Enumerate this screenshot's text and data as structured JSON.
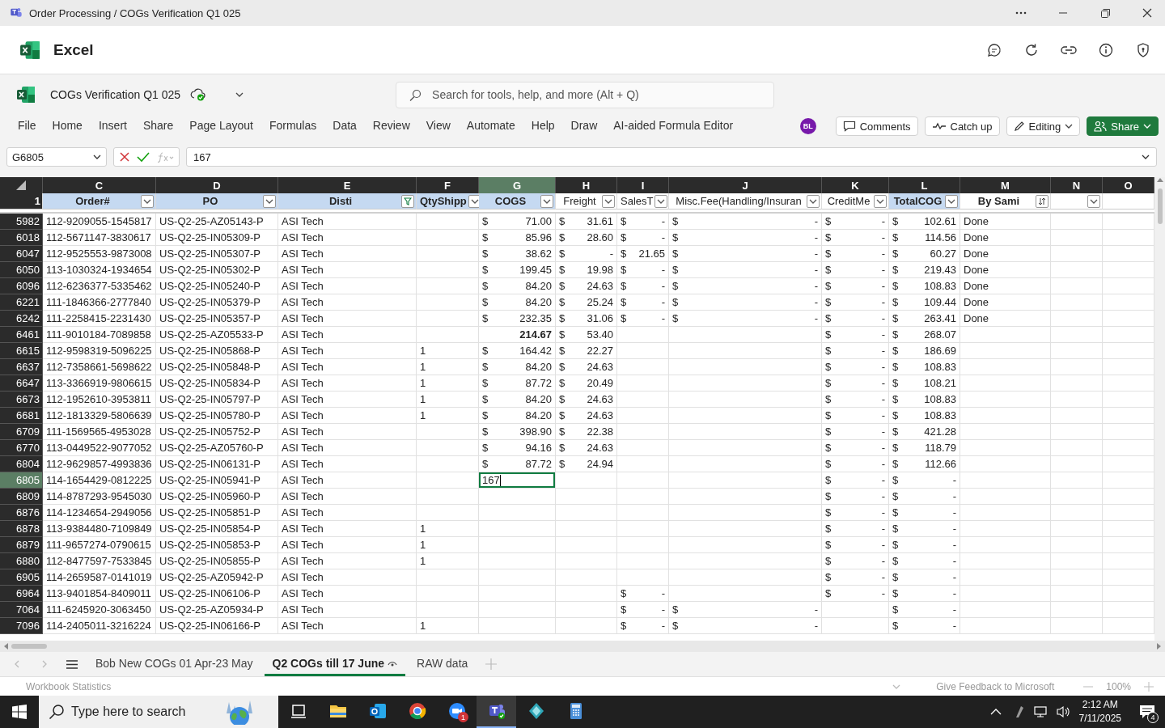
{
  "title_bar": {
    "title": "Order Processing / COGs Verification Q1 025"
  },
  "app_bar": {
    "name": "Excel"
  },
  "document": {
    "name": "COGs Verification Q1 025"
  },
  "search": {
    "placeholder": "Search for tools, help, and more (Alt + Q)"
  },
  "menu": [
    {
      "label": "File",
      "selected": false
    },
    {
      "label": "Home",
      "selected": false
    },
    {
      "label": "Insert",
      "selected": false
    },
    {
      "label": "Share",
      "selected": false
    },
    {
      "label": "Page Layout",
      "selected": false
    },
    {
      "label": "Formulas",
      "selected": false
    },
    {
      "label": "Data",
      "selected": false
    },
    {
      "label": "Review",
      "selected": false
    },
    {
      "label": "View",
      "selected": false
    },
    {
      "label": "Automate",
      "selected": false
    },
    {
      "label": "Help",
      "selected": false
    },
    {
      "label": "Draw",
      "selected": false
    },
    {
      "label": "AI-aided Formula Editor",
      "selected": false
    }
  ],
  "avatar": {
    "initials": "BL"
  },
  "buttons": [
    {
      "label": "Comments",
      "kind": "comments"
    },
    {
      "label": "Catch up",
      "kind": "catchup"
    },
    {
      "label": "Editing",
      "kind": "editing"
    },
    {
      "label": "Share",
      "kind": "share"
    }
  ],
  "formula_bar": {
    "name_box": "G6805",
    "formula": "167"
  },
  "grid": {
    "header_row": "1",
    "columns": [
      {
        "letter": "C",
        "title": "Order#",
        "bold": true,
        "fill": true,
        "kind": "dropdown",
        "selected": false
      },
      {
        "letter": "D",
        "title": "PO",
        "bold": true,
        "fill": true,
        "kind": "dropdown",
        "selected": false
      },
      {
        "letter": "E",
        "title": "Disti",
        "bold": true,
        "fill": true,
        "kind": "filtered",
        "selected": false
      },
      {
        "letter": "F",
        "title": "QtyShipp",
        "bold": true,
        "fill": true,
        "kind": "dropdown",
        "selected": false
      },
      {
        "letter": "G",
        "title": "COGS",
        "bold": true,
        "fill": true,
        "kind": "dropdown",
        "selected": true
      },
      {
        "letter": "H",
        "title": "Freight",
        "bold": false,
        "fill": false,
        "kind": "dropdown",
        "selected": false
      },
      {
        "letter": "I",
        "title": "SalesT",
        "bold": false,
        "fill": false,
        "kind": "dropdown",
        "selected": false
      },
      {
        "letter": "J",
        "title": "Misc.Fee(Handling/Insuran",
        "bold": false,
        "fill": false,
        "kind": "dropdown",
        "selected": false
      },
      {
        "letter": "K",
        "title": "CreditMe",
        "bold": false,
        "fill": false,
        "kind": "dropdown",
        "selected": false
      },
      {
        "letter": "L",
        "title": "TotalCOG",
        "bold": true,
        "fill": true,
        "kind": "dropdown",
        "selected": false
      },
      {
        "letter": "M",
        "title": "By Sami",
        "bold": true,
        "fill": false,
        "kind": "sorted",
        "selected": false
      },
      {
        "letter": "N",
        "fill": false,
        "kind": "dropdown",
        "selected": false
      },
      {
        "letter": "O",
        "fill": false,
        "selected": false
      }
    ],
    "rows": [
      {
        "num": "5982",
        "selected": false,
        "order": "112-9209055-1545817",
        "po": "US-Q2-25-AZ05143-P",
        "disti": "ASI Tech",
        "cogs": {
          "symbol": "$",
          "amount": "71.00"
        },
        "freight": {
          "symbol": "$",
          "amount": "31.61"
        },
        "sales_tax": {
          "symbol": "$",
          "amount": "-"
        },
        "misc_fee": {
          "symbol": "$",
          "amount": "-"
        },
        "credit_memo": {
          "symbol": "$",
          "amount": "-"
        },
        "total_cog": {
          "symbol": "$",
          "amount": "102.61"
        },
        "by_sami": "Done"
      },
      {
        "num": "6018",
        "selected": false,
        "order": "112-5671147-3830617",
        "po": "US-Q2-25-IN05309-P",
        "disti": "ASI Tech",
        "cogs": {
          "symbol": "$",
          "amount": "85.96"
        },
        "freight": {
          "symbol": "$",
          "amount": "28.60"
        },
        "sales_tax": {
          "symbol": "$",
          "amount": "-"
        },
        "misc_fee": {
          "symbol": "$",
          "amount": "-"
        },
        "credit_memo": {
          "symbol": "$",
          "amount": "-"
        },
        "total_cog": {
          "symbol": "$",
          "amount": "114.56"
        },
        "by_sami": "Done"
      },
      {
        "num": "6047",
        "selected": false,
        "order": "112-9525553-9873008",
        "po": "US-Q2-25-IN05307-P",
        "disti": "ASI Tech",
        "cogs": {
          "symbol": "$",
          "amount": "38.62"
        },
        "freight": {
          "symbol": "$",
          "amount": "-"
        },
        "sales_tax": {
          "symbol": "$",
          "amount": "21.65"
        },
        "misc_fee": {
          "symbol": "$",
          "amount": "-"
        },
        "credit_memo": {
          "symbol": "$",
          "amount": "-"
        },
        "total_cog": {
          "symbol": "$",
          "amount": "60.27"
        },
        "by_sami": "Done"
      },
      {
        "num": "6050",
        "selected": false,
        "order": "113-1030324-1934654",
        "po": "US-Q2-25-IN05302-P",
        "disti": "ASI Tech",
        "cogs": {
          "symbol": "$",
          "amount": "199.45"
        },
        "freight": {
          "symbol": "$",
          "amount": "19.98"
        },
        "sales_tax": {
          "symbol": "$",
          "amount": "-"
        },
        "misc_fee": {
          "symbol": "$",
          "amount": "-"
        },
        "credit_memo": {
          "symbol": "$",
          "amount": "-"
        },
        "total_cog": {
          "symbol": "$",
          "amount": "219.43"
        },
        "by_sami": "Done"
      },
      {
        "num": "6096",
        "selected": false,
        "order": "112-6236377-5335462",
        "po": "US-Q2-25-IN05240-P",
        "disti": "ASI Tech",
        "cogs": {
          "symbol": "$",
          "amount": "84.20"
        },
        "freight": {
          "symbol": "$",
          "amount": "24.63"
        },
        "sales_tax": {
          "symbol": "$",
          "amount": "-"
        },
        "misc_fee": {
          "symbol": "$",
          "amount": "-"
        },
        "credit_memo": {
          "symbol": "$",
          "amount": "-"
        },
        "total_cog": {
          "symbol": "$",
          "amount": "108.83"
        },
        "by_sami": "Done"
      },
      {
        "num": "6221",
        "selected": false,
        "order": "111-1846366-2777840",
        "po": "US-Q2-25-IN05379-P",
        "disti": "ASI Tech",
        "cogs": {
          "symbol": "$",
          "amount": "84.20"
        },
        "freight": {
          "symbol": "$",
          "amount": "25.24"
        },
        "sales_tax": {
          "symbol": "$",
          "amount": "-"
        },
        "misc_fee": {
          "symbol": "$",
          "amount": "-"
        },
        "credit_memo": {
          "symbol": "$",
          "amount": "-"
        },
        "total_cog": {
          "symbol": "$",
          "amount": "109.44"
        },
        "by_sami": "Done"
      },
      {
        "num": "6242",
        "selected": false,
        "order": "111-2258415-2231430",
        "po": "US-Q2-25-IN05357-P",
        "disti": "ASI Tech",
        "cogs": {
          "symbol": "$",
          "amount": "232.35"
        },
        "freight": {
          "symbol": "$",
          "amount": "31.06"
        },
        "sales_tax": {
          "symbol": "$",
          "amount": "-"
        },
        "misc_fee": {
          "symbol": "$",
          "amount": "-"
        },
        "credit_memo": {
          "symbol": "$",
          "amount": "-"
        },
        "total_cog": {
          "symbol": "$",
          "amount": "263.41"
        },
        "by_sami": "Done"
      },
      {
        "num": "6461",
        "selected": false,
        "order": "111-9010184-7089858",
        "po": "US-Q2-25-AZ05533-P",
        "disti": "ASI Tech",
        "cogs": {
          "amount": "214.67",
          "bold": true
        },
        "freight": {
          "symbol": "$",
          "amount": "53.40"
        },
        "credit_memo": {
          "symbol": "$",
          "amount": "-"
        },
        "total_cog": {
          "symbol": "$",
          "amount": "268.07"
        }
      },
      {
        "num": "6615",
        "selected": false,
        "order": "112-9598319-5096225",
        "po": "US-Q2-25-IN05868-P",
        "disti": "ASI Tech",
        "qty": "1",
        "cogs": {
          "symbol": "$",
          "amount": "164.42"
        },
        "freight": {
          "symbol": "$",
          "amount": "22.27"
        },
        "credit_memo": {
          "symbol": "$",
          "amount": "-"
        },
        "total_cog": {
          "symbol": "$",
          "amount": "186.69"
        }
      },
      {
        "num": "6637",
        "selected": false,
        "order": "112-7358661-5698622",
        "po": "US-Q2-25-IN05848-P",
        "disti": "ASI Tech",
        "qty": "1",
        "cogs": {
          "symbol": "$",
          "amount": "84.20"
        },
        "freight": {
          "symbol": "$",
          "amount": "24.63"
        },
        "credit_memo": {
          "symbol": "$",
          "amount": "-"
        },
        "total_cog": {
          "symbol": "$",
          "amount": "108.83"
        }
      },
      {
        "num": "6647",
        "selected": false,
        "order": "113-3366919-9806615",
        "po": "US-Q2-25-IN05834-P",
        "disti": "ASI Tech",
        "qty": "1",
        "cogs": {
          "symbol": "$",
          "amount": "87.72"
        },
        "freight": {
          "symbol": "$",
          "amount": "20.49"
        },
        "credit_memo": {
          "symbol": "$",
          "amount": "-"
        },
        "total_cog": {
          "symbol": "$",
          "amount": "108.21"
        }
      },
      {
        "num": "6673",
        "selected": false,
        "order": "112-1952610-3953811",
        "po": "US-Q2-25-IN05797-P",
        "disti": "ASI Tech",
        "qty": "1",
        "cogs": {
          "symbol": "$",
          "amount": "84.20"
        },
        "freight": {
          "symbol": "$",
          "amount": "24.63"
        },
        "credit_memo": {
          "symbol": "$",
          "amount": "-"
        },
        "total_cog": {
          "symbol": "$",
          "amount": "108.83"
        }
      },
      {
        "num": "6681",
        "selected": false,
        "order": "112-1813329-5806639",
        "po": "US-Q2-25-IN05780-P",
        "disti": "ASI Tech",
        "qty": "1",
        "cogs": {
          "symbol": "$",
          "amount": "84.20"
        },
        "freight": {
          "symbol": "$",
          "amount": "24.63"
        },
        "credit_memo": {
          "symbol": "$",
          "amount": "-"
        },
        "total_cog": {
          "symbol": "$",
          "amount": "108.83"
        }
      },
      {
        "num": "6709",
        "selected": false,
        "order": "111-1569565-4953028",
        "po": "US-Q2-25-IN05752-P",
        "disti": "ASI Tech",
        "cogs": {
          "symbol": "$",
          "amount": "398.90"
        },
        "freight": {
          "symbol": "$",
          "amount": "22.38"
        },
        "credit_memo": {
          "symbol": "$",
          "amount": "-"
        },
        "total_cog": {
          "symbol": "$",
          "amount": "421.28"
        }
      },
      {
        "num": "6770",
        "selected": false,
        "order": "113-0449522-9077052",
        "po": "US-Q2-25-AZ05760-P",
        "disti": "ASI Tech",
        "cogs": {
          "symbol": "$",
          "amount": "94.16"
        },
        "freight": {
          "symbol": "$",
          "amount": "24.63"
        },
        "credit_memo": {
          "symbol": "$",
          "amount": "-"
        },
        "total_cog": {
          "symbol": "$",
          "amount": "118.79"
        }
      },
      {
        "num": "6804",
        "selected": false,
        "order": "112-9629857-4993836",
        "po": "US-Q2-25-IN06131-P",
        "disti": "ASI Tech",
        "cogs": {
          "symbol": "$",
          "amount": "87.72"
        },
        "freight": {
          "symbol": "$",
          "amount": "24.94"
        },
        "credit_memo": {
          "symbol": "$",
          "amount": "-"
        },
        "total_cog": {
          "symbol": "$",
          "amount": "112.66"
        }
      },
      {
        "num": "6805",
        "selected": true,
        "order": "114-1654429-0812225",
        "po": "US-Q2-25-IN05941-P",
        "disti": "ASI Tech",
        "cogs": {
          "editing": true,
          "amount": "167"
        },
        "credit_memo": {
          "symbol": "$",
          "amount": "-"
        },
        "total_cog": {
          "symbol": "$",
          "amount": "-"
        }
      },
      {
        "num": "6809",
        "selected": false,
        "order": "114-8787293-9545030",
        "po": "US-Q2-25-IN05960-P",
        "disti": "ASI Tech",
        "credit_memo": {
          "symbol": "$",
          "amount": "-"
        },
        "total_cog": {
          "symbol": "$",
          "amount": "-"
        }
      },
      {
        "num": "6876",
        "selected": false,
        "order": "114-1234654-2949056",
        "po": "US-Q2-25-IN05851-P",
        "disti": "ASI Tech",
        "credit_memo": {
          "symbol": "$",
          "amount": "-"
        },
        "total_cog": {
          "symbol": "$",
          "amount": "-"
        }
      },
      {
        "num": "6878",
        "selected": false,
        "order": "113-9384480-7109849",
        "po": "US-Q2-25-IN05854-P",
        "disti": "ASI Tech",
        "qty": "1",
        "credit_memo": {
          "symbol": "$",
          "amount": "-"
        },
        "total_cog": {
          "symbol": "$",
          "amount": "-"
        }
      },
      {
        "num": "6879",
        "selected": false,
        "order": "111-9657274-0790615",
        "po": "US-Q2-25-IN05853-P",
        "disti": "ASI Tech",
        "qty": "1",
        "credit_memo": {
          "symbol": "$",
          "amount": "-"
        },
        "total_cog": {
          "symbol": "$",
          "amount": "-"
        }
      },
      {
        "num": "6880",
        "selected": false,
        "order": "112-8477597-7533845",
        "po": "US-Q2-25-IN05855-P",
        "disti": "ASI Tech",
        "qty": "1",
        "credit_memo": {
          "symbol": "$",
          "amount": "-"
        },
        "total_cog": {
          "symbol": "$",
          "amount": "-"
        }
      },
      {
        "num": "6905",
        "selected": false,
        "order": "114-2659587-0141019",
        "po": "US-Q2-25-AZ05942-P",
        "disti": "ASI Tech",
        "credit_memo": {
          "symbol": "$",
          "amount": "-"
        },
        "total_cog": {
          "symbol": "$",
          "amount": "-"
        }
      },
      {
        "num": "6964",
        "selected": false,
        "order": "113-9401854-8409011",
        "po": "US-Q2-25-IN06106-P",
        "disti": "ASI Tech",
        "sales_tax": {
          "symbol": "$",
          "amount": "-"
        },
        "credit_memo": {
          "symbol": "$",
          "amount": "-"
        },
        "total_cog": {
          "symbol": "$",
          "amount": "-"
        }
      },
      {
        "num": "7064",
        "selected": false,
        "order": "111-6245920-3063450",
        "po": "US-Q2-25-AZ05934-P",
        "disti": "ASI Tech",
        "sales_tax": {
          "symbol": "$",
          "amount": "-"
        },
        "misc_fee": {
          "symbol": "$",
          "amount": "-"
        },
        "total_cog": {
          "symbol": "$",
          "amount": "-"
        }
      },
      {
        "num": "7096",
        "selected": false,
        "order": "114-2405011-3216224",
        "po": "US-Q2-25-IN06166-P",
        "disti": "ASI Tech",
        "qty": "1",
        "sales_tax": {
          "symbol": "$",
          "amount": "-"
        },
        "misc_fee": {
          "symbol": "$",
          "amount": "-"
        },
        "total_cog": {
          "symbol": "$",
          "amount": "-"
        }
      }
    ]
  },
  "sheet_tabs": [
    {
      "label": "Bob New COGs 01 Apr-23 May",
      "selected": false
    },
    {
      "label": "Q2 COGs till 17 June",
      "selected": true
    },
    {
      "label": "RAW data",
      "selected": false
    }
  ],
  "status_bar": {
    "statistics": "Workbook Statistics",
    "feedback": "Give Feedback to Microsoft",
    "zoom": "100%"
  },
  "taskbar": {
    "search_placeholder": "Type here to search",
    "apps": [
      {
        "kind": "taskview",
        "selected": false
      },
      {
        "kind": "folder",
        "selected": false
      },
      {
        "kind": "outlook",
        "selected": false
      },
      {
        "kind": "chrome",
        "selected": false
      },
      {
        "kind": "zoom",
        "selected": false,
        "badge": "1"
      },
      {
        "kind": "teams",
        "selected": true
      },
      {
        "kind": "gem",
        "selected": false
      },
      {
        "kind": "calculator",
        "selected": false
      }
    ],
    "time": "2:12 AM",
    "date": "7/11/2025",
    "notifications": "4"
  }
}
